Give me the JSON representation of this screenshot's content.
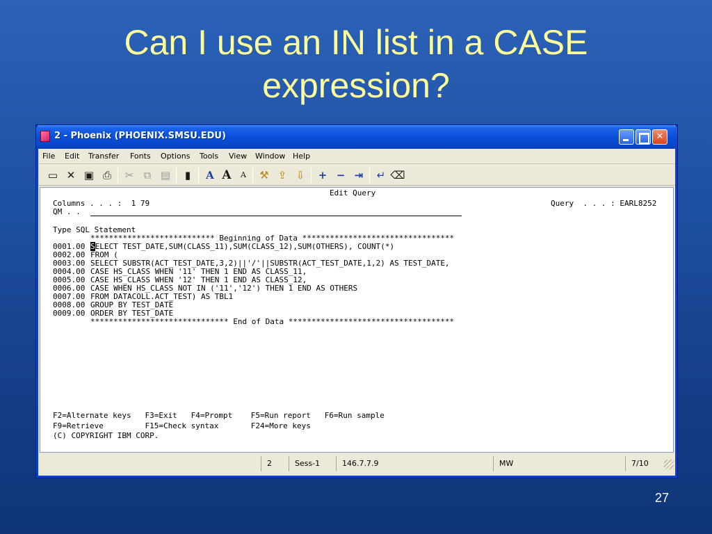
{
  "slide": {
    "title_line1": "Can I use an IN list in a CASE",
    "title_line2": "expression?",
    "page_number": "27"
  },
  "window": {
    "title": "2 - Phoenix (PHOENIX.SMSU.EDU)",
    "controls": {
      "minimize": "minimize",
      "maximize": "maximize",
      "close": "✕"
    }
  },
  "menu": {
    "items": [
      "File",
      "Edit",
      "Transfer",
      "Fonts",
      "Options",
      "Tools",
      "View",
      "Window",
      "Help"
    ]
  },
  "toolbar": {
    "icons": [
      "monitor-icon",
      "disconnect-icon",
      "save-icon",
      "print-icon",
      "cut-icon",
      "copy-icon",
      "paste-icon",
      "macro-icon",
      "font-icon",
      "font-larger-icon",
      "font-smaller-icon",
      "tools-icon",
      "send-file-icon",
      "receive-file-icon",
      "plus-icon",
      "minus-icon",
      "tab-icon",
      "enter-icon",
      "erase-icon"
    ]
  },
  "terminal": {
    "header": "Edit Query",
    "columns_label": "Columns . . . :  1 79",
    "query_label": "Query  . . . : EARL8252",
    "qm_label": "QM . .",
    "type_label": "Type SQL Statement",
    "begin_banner": "*************************** Beginning of Data *********************************",
    "lines": [
      {
        "num": "0001.00",
        "text": "SELECT TEST_DATE,SUM(CLASS_11),SUM(CLASS_12),SUM(OTHERS), COUNT(*)"
      },
      {
        "num": "0002.00",
        "text": "FROM ("
      },
      {
        "num": "0003.00",
        "text": "SELECT SUBSTR(ACT_TEST_DATE,3,2)||'/'||SUBSTR(ACT_TEST_DATE,1,2) AS TEST_DATE,"
      },
      {
        "num": "0004.00",
        "text": "CASE HS_CLASS WHEN '11' THEN 1 END AS CLASS_11,"
      },
      {
        "num": "0005.00",
        "text": "CASE HS_CLASS WHEN '12' THEN 1 END AS CLASS_12,"
      },
      {
        "num": "0006.00",
        "text": "CASE WHEN HS_CLASS NOT IN ('11','12') THEN 1 END AS OTHERS"
      },
      {
        "num": "0007.00",
        "text": "FROM DATACOLL.ACT_TEST) AS TBL1"
      },
      {
        "num": "0008.00",
        "text": "GROUP BY TEST_DATE"
      },
      {
        "num": "0009.00",
        "text": "ORDER BY TEST_DATE"
      }
    ],
    "end_banner": "****************************** End of Data ************************************",
    "fkeys_line1": "F2=Alternate keys   F3=Exit   F4=Prompt    F5=Run report   F6=Run sample",
    "fkeys_line2": "F9=Retrieve         F15=Check syntax       F24=More keys",
    "copyright": "(C) COPYRIGHT IBM CORP."
  },
  "status": {
    "cell1": "2",
    "cell2": "Sess-1",
    "cell3": "146.7.7.9",
    "cell4": "MW",
    "cell5": "7/10"
  }
}
